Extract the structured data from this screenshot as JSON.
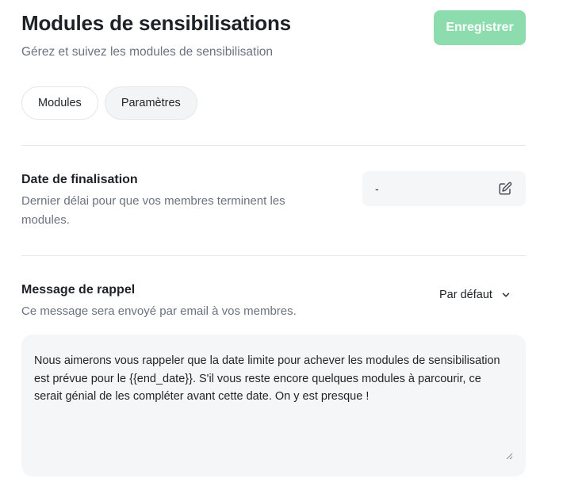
{
  "header": {
    "title": "Modules de sensibilisations",
    "subtitle": "Gérez et suivez les modules de sensibilisation",
    "save_label": "Enregistrer"
  },
  "tabs": [
    {
      "label": "Modules",
      "active": false
    },
    {
      "label": "Paramètres",
      "active": true
    }
  ],
  "deadline": {
    "title": "Date de finalisation",
    "description": "Dernier délai pour que vos membres terminent les modules.",
    "value": "-",
    "edit_icon": "edit-icon"
  },
  "reminder": {
    "title": "Message de rappel",
    "description": "Ce message sera envoyé par email à vos membres.",
    "template_selected": "Par défaut",
    "message": "Nous aimerons vous rappeler que la date limite pour achever les modules de sensibilisation est prévue pour le {{end_date}}. S'il vous reste encore quelques modules à parcourir, ce serait génial de les compléter avant cette date. On y est presque !"
  },
  "colors": {
    "accent": "#8ddcae",
    "muted_text": "#6b7280",
    "field_bg": "#f5f6f7"
  }
}
